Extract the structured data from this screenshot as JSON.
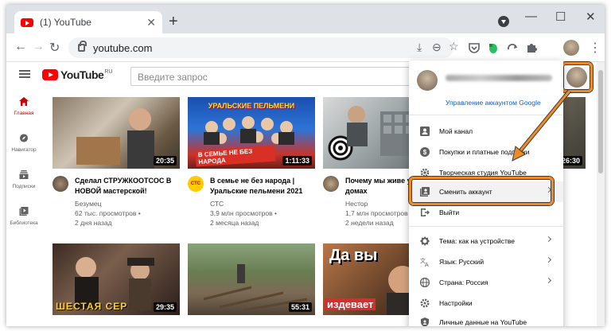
{
  "browser": {
    "tab_title": "(1) YouTube",
    "tab_close": "✕",
    "new_tab": "+",
    "minimize": "—",
    "maximize": "☐",
    "close": "✕",
    "url": "youtube.com"
  },
  "youtube": {
    "logo_text": "YouTube",
    "logo_region": "RU",
    "search_placeholder": "Введите запрос"
  },
  "sidebar": {
    "items": [
      {
        "label": "Главная",
        "icon": "home-icon",
        "active": true
      },
      {
        "label": "Навигатор",
        "icon": "compass-icon"
      },
      {
        "label": "Подписки",
        "icon": "subscriptions-icon"
      },
      {
        "label": "Библиотека",
        "icon": "library-icon"
      }
    ]
  },
  "videos": [
    {
      "title": "Сделал СТРУЖКООТСОС В НОВОЙ мастерской!",
      "channel": "Безумец",
      "views": "62 тыс. просмотров •",
      "age": "2 дня назад",
      "duration": "20:35"
    },
    {
      "title": "В семье не без народа | Уральские пельмени 2021",
      "channel": "СТС",
      "views": "3,9 млн просмотров •",
      "age": "2 месяца назад",
      "duration": "1:11:33",
      "avatar_text": "СТС",
      "thumb_text_top": "УРАЛЬСКИЕ ПЕЛЬМЕНИ",
      "thumb_text_bottom": "В СЕМЬЕ НЕ БЕЗ НАРОДА"
    },
    {
      "title": "Почему мы живе урод­ливых домах",
      "channel": "Нестор",
      "views": "1,7 млн просмотров •",
      "age": "2 недели назад"
    },
    {
      "duration": "26:30"
    },
    {
      "duration": "29:35",
      "thumb_text": "ШЕСТАЯ СЕР"
    },
    {
      "duration": "55:31"
    },
    {
      "thumb_text_top": "Да вы",
      "thumb_text_bottom": "издевает"
    }
  ],
  "account_menu": {
    "manage": "Управление аккаунтом Google",
    "items": [
      {
        "label": "Мой канал",
        "icon": "person-icon"
      },
      {
        "label": "Покупки и платные подписки",
        "icon": "dollar-icon"
      },
      {
        "label": "Творческая студия YouTube",
        "icon": "settings-gear-icon"
      },
      {
        "label": "Сменить аккаунт",
        "icon": "switch-account-icon",
        "chevron": true
      },
      {
        "label": "Выйти",
        "icon": "logout-icon"
      },
      {
        "label": "Тема: как на устройстве",
        "icon": "theme-icon",
        "chevron": true
      },
      {
        "label": "Язык: Русский",
        "icon": "translate-icon",
        "chevron": true
      },
      {
        "label": "Страна: Россия",
        "icon": "globe-icon",
        "chevron": true
      },
      {
        "label": "Настройки",
        "icon": "gear-icon"
      },
      {
        "label": "Личные данные на YouTube",
        "icon": "shield-icon"
      }
    ]
  },
  "colors": {
    "youtube_red": "#ff0000",
    "annotation_orange": "#f08a24",
    "link_blue": "#065fd4"
  }
}
